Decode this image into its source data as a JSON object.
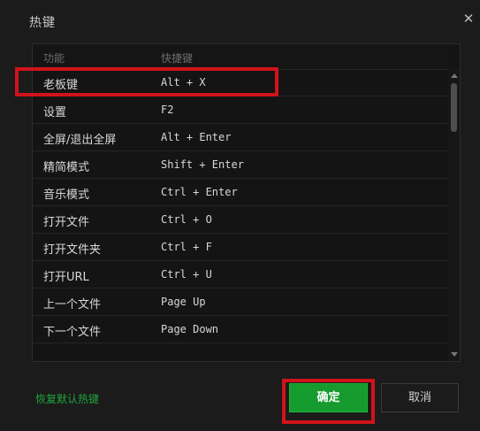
{
  "dialog": {
    "title": "热键",
    "close_glyph": "✕"
  },
  "table": {
    "headers": [
      "功能",
      "快捷键"
    ],
    "rows": [
      {
        "function": "老板键",
        "shortcut": "Alt + X"
      },
      {
        "function": "设置",
        "shortcut": "F2"
      },
      {
        "function": "全屏/退出全屏",
        "shortcut": "Alt + Enter"
      },
      {
        "function": "精简模式",
        "shortcut": "Shift + Enter"
      },
      {
        "function": "音乐模式",
        "shortcut": "Ctrl + Enter"
      },
      {
        "function": "打开文件",
        "shortcut": "Ctrl + O"
      },
      {
        "function": "打开文件夹",
        "shortcut": "Ctrl + F"
      },
      {
        "function": "打开URL",
        "shortcut": "Ctrl + U"
      },
      {
        "function": "上一个文件",
        "shortcut": "Page Up"
      },
      {
        "function": "下一个文件",
        "shortcut": "Page Down"
      }
    ]
  },
  "footer": {
    "restore_label": "恢复默认热键",
    "ok_label": "确定",
    "cancel_label": "取消"
  },
  "colors": {
    "accent_green": "#169b2e",
    "link_green": "#1fa53c",
    "annotation_red": "#d0131b"
  }
}
